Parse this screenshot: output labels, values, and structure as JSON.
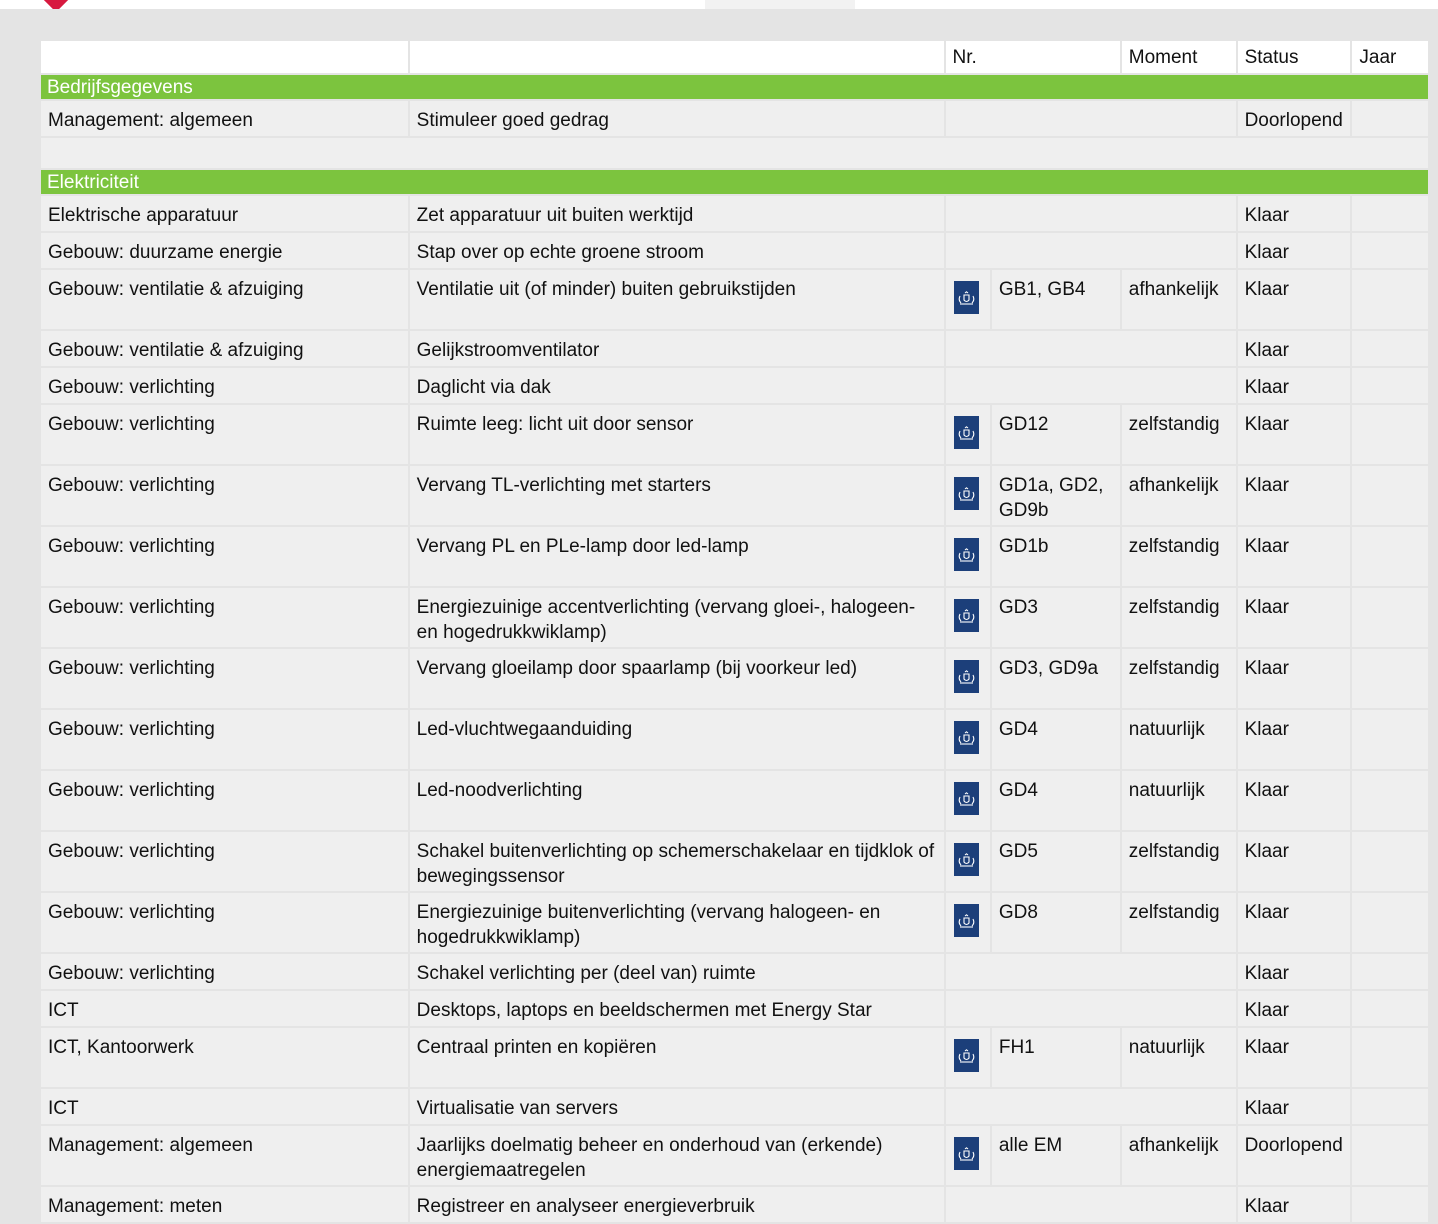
{
  "header": {
    "nr": "Nr.",
    "moment": "Moment",
    "status": "Status",
    "jaar": "Jaar"
  },
  "sections": [
    {
      "title": "Bedrijfsgegevens"
    },
    {
      "title": "Elektriciteit"
    }
  ],
  "bedrijf_rows": [
    {
      "category": "Management: algemeen",
      "measure": "Stimuleer goed gedrag",
      "nr": "",
      "moment": "",
      "status": "Doorlopend",
      "jaar": ""
    }
  ],
  "elek_rows": [
    {
      "category": "Elektrische apparatuur",
      "measure": "Zet apparatuur uit buiten werktijd",
      "nr": "",
      "moment": "",
      "status": "Klaar",
      "jaar": ""
    },
    {
      "category": "Gebouw: duurzame energie",
      "measure": "Stap over op echte groene stroom",
      "nr": "",
      "moment": "",
      "status": "Klaar",
      "jaar": ""
    },
    {
      "category": "Gebouw: ventilatie & afzuiging",
      "measure": "Ventilatie uit (of minder) buiten gebruikstijden",
      "nr": "GB1, GB4",
      "moment": "afhankelijk",
      "status": "Klaar",
      "jaar": "",
      "icon": "rijksoverheid-crest-icon"
    },
    {
      "category": "Gebouw: ventilatie & afzuiging",
      "measure": "Gelijkstroomventilator",
      "nr": "",
      "moment": "",
      "status": "Klaar",
      "jaar": ""
    },
    {
      "category": "Gebouw: verlichting",
      "measure": "Daglicht via dak",
      "nr": "",
      "moment": "",
      "status": "Klaar",
      "jaar": ""
    },
    {
      "category": "Gebouw: verlichting",
      "measure": "Ruimte leeg: licht uit door sensor",
      "nr": "GD12",
      "moment": "zelfstandig",
      "status": "Klaar",
      "jaar": "",
      "icon": "rijksoverheid-crest-icon"
    },
    {
      "category": "Gebouw: verlichting",
      "measure": "Vervang TL-verlichting met starters",
      "nr": "GD1a, GD2, GD9b",
      "moment": "afhankelijk",
      "status": "Klaar",
      "jaar": "",
      "icon": "rijksoverheid-crest-icon"
    },
    {
      "category": "Gebouw: verlichting",
      "measure": "Vervang PL en PLe-lamp door led-lamp",
      "nr": "GD1b",
      "moment": "zelfstandig",
      "status": "Klaar",
      "jaar": "",
      "icon": "rijksoverheid-crest-icon"
    },
    {
      "category": "Gebouw: verlichting",
      "measure": "Energiezuinige accentverlichting (vervang gloei-, halogeen- en hogedrukkwiklamp)",
      "nr": "GD3",
      "moment": "zelfstandig",
      "status": "Klaar",
      "jaar": "",
      "icon": "rijksoverheid-crest-icon"
    },
    {
      "category": "Gebouw: verlichting",
      "measure": "Vervang gloeilamp door spaarlamp (bij voorkeur led)",
      "nr": "GD3, GD9a",
      "moment": "zelfstandig",
      "status": "Klaar",
      "jaar": "",
      "icon": "rijksoverheid-crest-icon"
    },
    {
      "category": "Gebouw: verlichting",
      "measure": "Led-vluchtwegaanduiding",
      "nr": "GD4",
      "moment": "natuurlijk",
      "status": "Klaar",
      "jaar": "",
      "icon": "rijksoverheid-crest-icon"
    },
    {
      "category": "Gebouw: verlichting",
      "measure": "Led-noodverlichting",
      "nr": "GD4",
      "moment": "natuurlijk",
      "status": "Klaar",
      "jaar": "",
      "icon": "rijksoverheid-crest-icon"
    },
    {
      "category": "Gebouw: verlichting",
      "measure": "Schakel buitenverlichting op schemerschakelaar en tijdklok of bewegingssensor",
      "nr": "GD5",
      "moment": "zelfstandig",
      "status": "Klaar",
      "jaar": "",
      "icon": "rijksoverheid-crest-icon"
    },
    {
      "category": "Gebouw: verlichting",
      "measure": "Energiezuinige buitenverlichting (vervang halogeen- en hogedrukkwiklamp)",
      "nr": "GD8",
      "moment": "zelfstandig",
      "status": "Klaar",
      "jaar": "",
      "icon": "rijksoverheid-crest-icon"
    },
    {
      "category": "Gebouw: verlichting",
      "measure": "Schakel verlichting per (deel van) ruimte",
      "nr": "",
      "moment": "",
      "status": "Klaar",
      "jaar": ""
    },
    {
      "category": "ICT",
      "measure": "Desktops, laptops en beeldschermen met Energy Star",
      "nr": "",
      "moment": "",
      "status": "Klaar",
      "jaar": ""
    },
    {
      "category": "ICT, Kantoorwerk",
      "measure": "Centraal printen en kopiëren",
      "nr": "FH1",
      "moment": "natuurlijk",
      "status": "Klaar",
      "jaar": "",
      "icon": "rijksoverheid-crest-icon"
    },
    {
      "category": "ICT",
      "measure": "Virtualisatie van servers",
      "nr": "",
      "moment": "",
      "status": "Klaar",
      "jaar": ""
    },
    {
      "category": "Management: algemeen",
      "measure": "Jaarlijks doelmatig beheer en onderhoud van (erkende) energiemaatregelen",
      "nr": "alle EM",
      "moment": "afhankelijk",
      "status": "Doorlopend",
      "jaar": "",
      "icon": "rijksoverheid-crest-icon"
    },
    {
      "category": "Management: meten",
      "measure": "Registreer en analyseer energieverbruik",
      "nr": "",
      "moment": "",
      "status": "Klaar",
      "jaar": ""
    }
  ],
  "colors": {
    "accent_green": "#7cc43e",
    "brand_red": "#d7193f",
    "crest_blue": "#1c3f7a"
  }
}
